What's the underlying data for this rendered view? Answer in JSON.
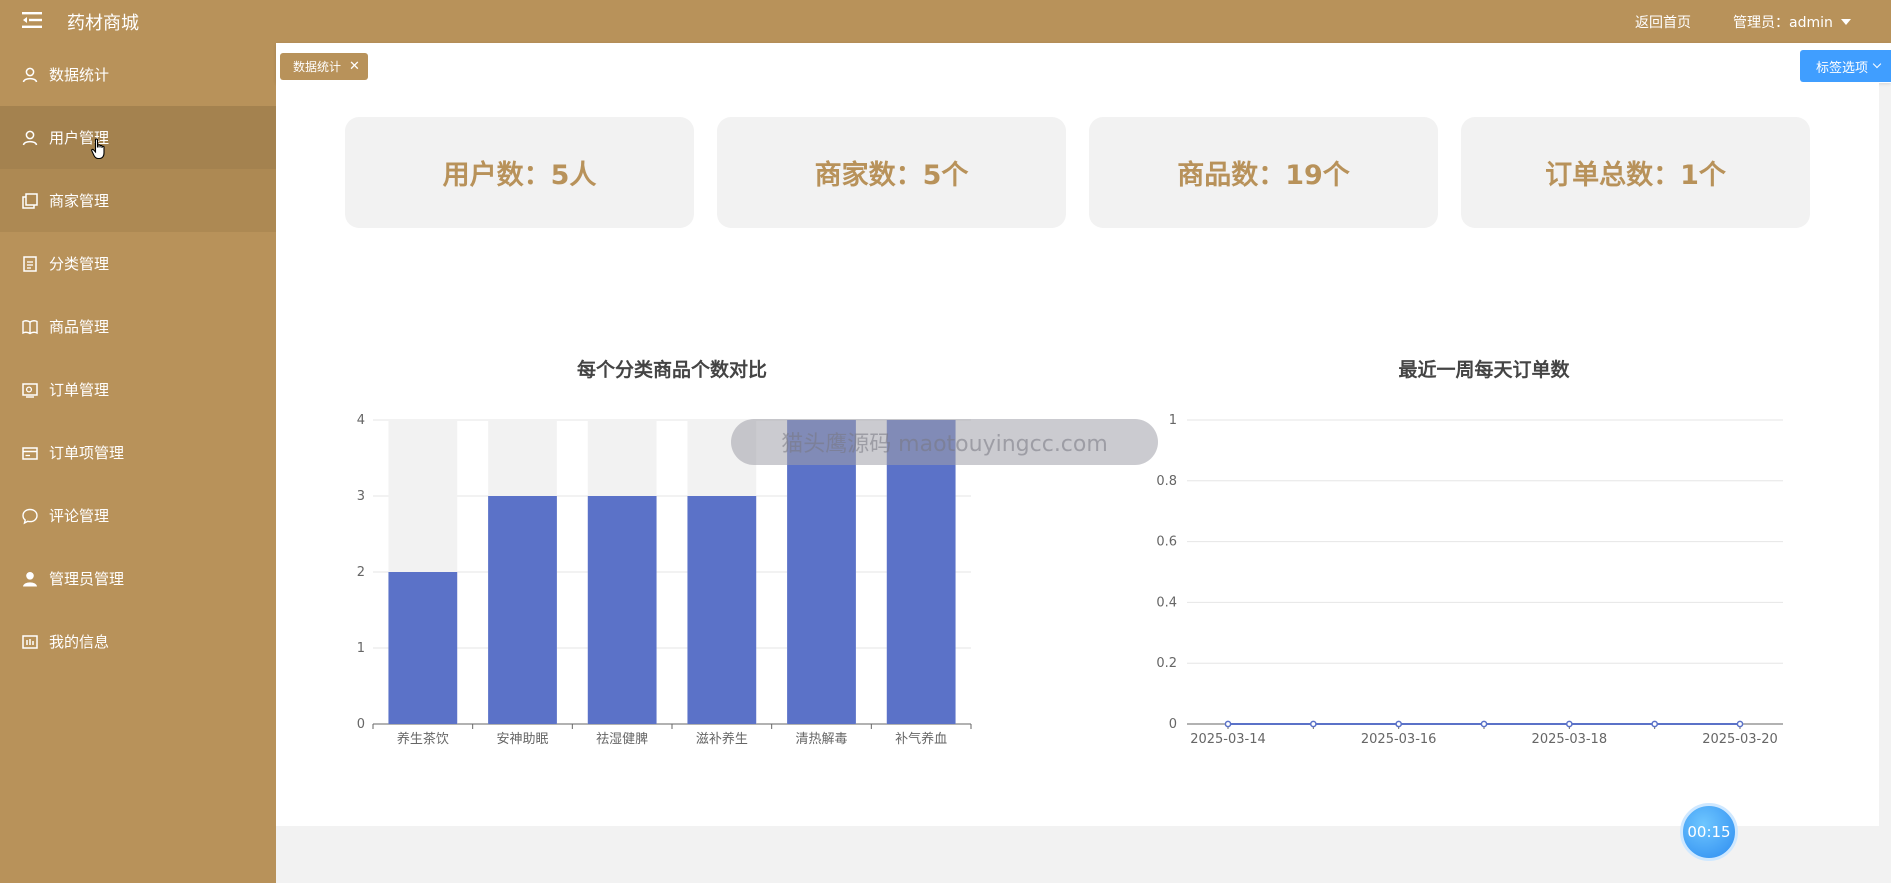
{
  "app": {
    "title": "药材商城"
  },
  "header": {
    "home_link": "返回首页",
    "admin_label": "管理员：admin"
  },
  "sidebar": {
    "items": [
      {
        "label": "数据统计",
        "icon": "user-icon"
      },
      {
        "label": "用户管理",
        "icon": "user-icon"
      },
      {
        "label": "商家管理",
        "icon": "copy-icon"
      },
      {
        "label": "分类管理",
        "icon": "document-icon"
      },
      {
        "label": "商品管理",
        "icon": "book-icon"
      },
      {
        "label": "订单管理",
        "icon": "picture-icon"
      },
      {
        "label": "订单项管理",
        "icon": "card-icon"
      },
      {
        "label": "评论管理",
        "icon": "chat-icon"
      },
      {
        "label": "管理员管理",
        "icon": "user-solid-icon"
      },
      {
        "label": "我的信息",
        "icon": "data-icon"
      }
    ]
  },
  "tabs": {
    "active_tab": "数据统计",
    "close_glyph": "✕",
    "options_label": "标签选项"
  },
  "stats": [
    {
      "label": "用户数：5人"
    },
    {
      "label": "商家数：5个"
    },
    {
      "label": "商品数：19个"
    },
    {
      "label": "订单总数：1个"
    }
  ],
  "watermark": "猫头鹰源码 maotouyingcc.com",
  "timer": "00:15",
  "colors": {
    "brand": "#b8925a",
    "bar": "#5b72c8",
    "bar_background": "#f2f2f2",
    "accent": "#409eff"
  },
  "chart_data": [
    {
      "type": "bar",
      "title": "每个分类商品个数对比",
      "categories": [
        "养生茶饮",
        "安神助眠",
        "祛湿健脾",
        "滋补养生",
        "清热解毒",
        "补气养血"
      ],
      "values": [
        2,
        3,
        3,
        3,
        4,
        4
      ],
      "ylim": [
        0,
        4
      ],
      "yticks": [
        "0",
        "1",
        "2",
        "3",
        "4"
      ],
      "show_background": true,
      "grid": true
    },
    {
      "type": "line",
      "title": "最近一周每天订单数",
      "x": [
        "2025-03-14",
        "2025-03-15",
        "2025-03-16",
        "2025-03-17",
        "2025-03-18",
        "2025-03-19",
        "2025-03-20"
      ],
      "xticks": [
        "2025-03-14",
        "2025-03-16",
        "2025-03-18",
        "2025-03-20"
      ],
      "values": [
        0,
        0,
        0,
        0,
        0,
        0,
        0
      ],
      "ylim": [
        0,
        1
      ],
      "yticks": [
        "0",
        "0.2",
        "0.4",
        "0.6",
        "0.8",
        "1"
      ],
      "grid": true
    }
  ]
}
